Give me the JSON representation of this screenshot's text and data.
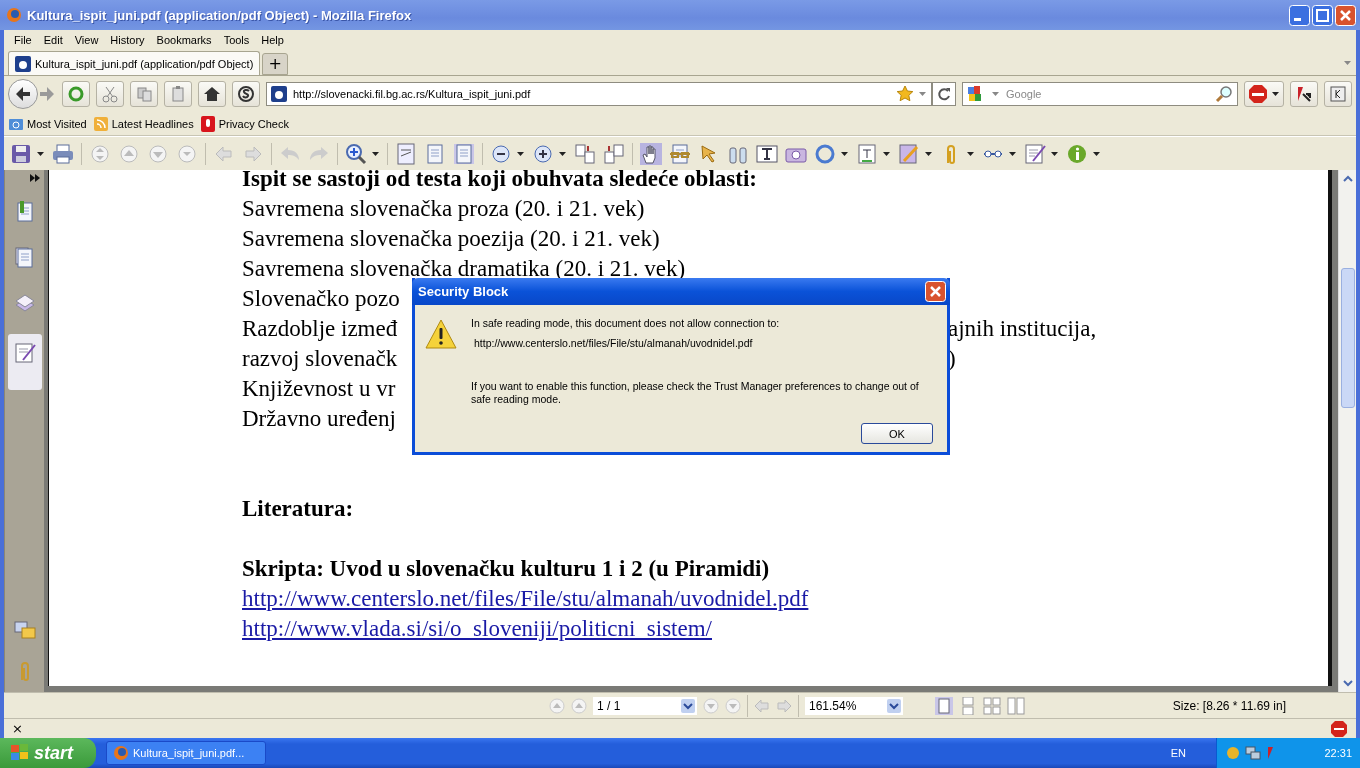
{
  "window": {
    "title": "Kultura_ispit_juni.pdf (application/pdf Object) - Mozilla Firefox"
  },
  "menu": [
    "File",
    "Edit",
    "View",
    "History",
    "Bookmarks",
    "Tools",
    "Help"
  ],
  "tabs": [
    {
      "label": "Kultura_ispit_juni.pdf (application/pdf Object)",
      "selected": true
    }
  ],
  "new_tab": "+",
  "address": {
    "value": "http://slovenacki.fil.bg.ac.rs/Kultura_ispit_juni.pdf"
  },
  "search": {
    "placeholder": "Google"
  },
  "bookmarks": [
    "Most Visited",
    "Latest Headlines",
    "Privacy Check"
  ],
  "document": {
    "lines": [
      {
        "kind": "heading",
        "text": "Ispit se sastoji od testa koji obuhvata sledeće oblasti:"
      },
      {
        "kind": "text",
        "text": "Savremena slovenačka proza (20. i 21. vek)"
      },
      {
        "kind": "text",
        "text": "Savremena slovenačka poezija (20. i 21. vek)"
      },
      {
        "kind": "text",
        "text": "Savremena slovenačka dramatika (20. i 21. vek)"
      },
      {
        "kind": "text",
        "text": "Slovenačko pozo"
      },
      {
        "kind": "text",
        "text": "Razdoblje izmeđ",
        "right": "ajnih institucija,"
      },
      {
        "kind": "text",
        "text": "razvoj slovenačk",
        "right": ")"
      },
      {
        "kind": "text",
        "text": "Književnost u vr"
      },
      {
        "kind": "text",
        "text": "Državno uređenj"
      },
      {
        "kind": "blank"
      },
      {
        "kind": "blank"
      },
      {
        "kind": "heading",
        "text": "Literatura:"
      },
      {
        "kind": "blank"
      },
      {
        "kind": "heading",
        "text": "Skripta: Uvod u slovenačku kulturu 1 i 2 (u Piramidi)"
      },
      {
        "kind": "link",
        "text": "http://www.centerslo.net/files/File/stu/almanah/uvodnidel.pdf"
      },
      {
        "kind": "link",
        "text": "http://www.vlada.si/si/o_sloveniji/politicni_sistem/"
      }
    ]
  },
  "dialog": {
    "title": "Security Block",
    "message": "In safe reading mode, this document does not allow connection to:",
    "url": "http://www.centerslo.net/files/File/stu/almanah/uvodnidel.pdf",
    "hint": "If you want to enable this function, please check the Trust Manager preferences to change out of safe reading mode.",
    "button": "OK"
  },
  "pdf_status": {
    "page": "1 / 1",
    "zoom": "161.54%",
    "size": "Size: [8.26 * 11.69 in]"
  },
  "status_bar": {
    "close": "×"
  },
  "taskbar": {
    "start": "start",
    "tasks": [
      {
        "label": "Kultura_ispit_juni.pdf...",
        "selected": false
      }
    ],
    "language": "EN",
    "clock": "22:31"
  }
}
